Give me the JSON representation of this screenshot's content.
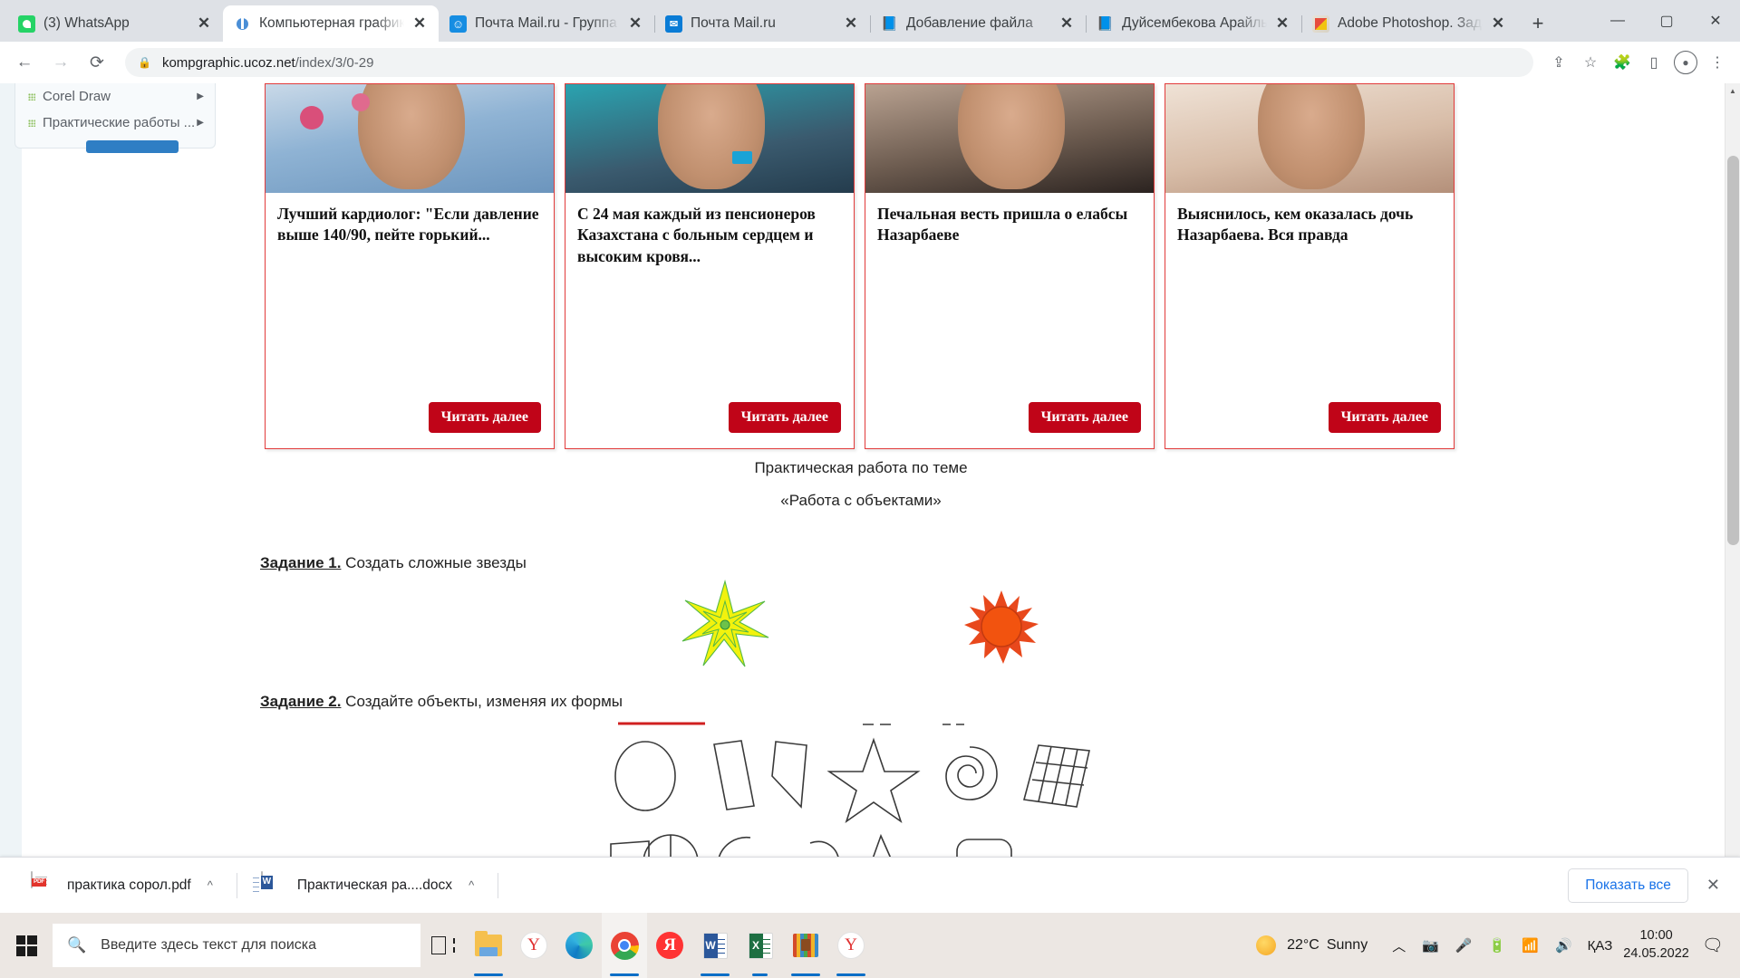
{
  "browser": {
    "tabs": [
      {
        "title": "(3) WhatsApp",
        "favicon": "whatsapp-icon",
        "active": false
      },
      {
        "title": "Компьютерная графика",
        "favicon": "ucoz-icon",
        "active": true
      },
      {
        "title": "Почта Mail.ru - Группа",
        "favicon": "mailru-icon",
        "active": false
      },
      {
        "title": "Почта Mail.ru",
        "favicon": "mailru-envelope-icon",
        "active": false
      },
      {
        "title": "Добавление файла",
        "favicon": "book-icon",
        "active": false
      },
      {
        "title": "Дуйсембекова Арайлым",
        "favicon": "book-icon",
        "active": false
      },
      {
        "title": "Adobe Photoshop. Задание",
        "favicon": "photoshop-icon",
        "active": false
      }
    ],
    "new_tab_label": "+",
    "window_controls": {
      "minimize": "—",
      "maximize": "▢",
      "close": "✕"
    },
    "nav": {
      "back": "←",
      "forward": "→",
      "reload": "⟳"
    },
    "address": {
      "lock_icon": "lock-icon",
      "host": "kompgraphic.ucoz.net",
      "path": "/index/3/0-29"
    },
    "toolbar_icons": [
      "share-icon",
      "bookmark-star-icon",
      "extensions-puzzle-icon",
      "sidepanel-icon",
      "profile-avatar-icon",
      "menu-kebab-icon"
    ]
  },
  "sidebar": {
    "items": [
      {
        "label": "Corel Draw",
        "arrow": "▶"
      },
      {
        "label": "Практические работы ...",
        "arrow": "▶"
      }
    ]
  },
  "news_cards": [
    {
      "title": "Лучший кардиолог: \"Если давление выше 140/90, пейте горький...",
      "button": "Читать далее"
    },
    {
      "title": "С 24 мая каждый из пенсионеров Казахстана с больным сердцем и высоким кровя...",
      "button": "Читать далее"
    },
    {
      "title": "Печальная весть пришла о елабсы Назарбаеве",
      "button": "Читать далее"
    },
    {
      "title": "Выяснилось, кем оказалась дочь Назарбаева. Вся правда",
      "button": "Читать далее"
    }
  ],
  "document": {
    "heading_line1": "Практическая работа по теме",
    "heading_line2": "«Работа с объектами»",
    "task1_label": "Задание 1.",
    "task1_text": " Создать сложные звезды",
    "task2_label": "Задание 2.",
    "task2_text": " Создайте объекты, изменяя их формы"
  },
  "downloads_bar": {
    "items": [
      {
        "name": "практика соpол.pdf",
        "icon": "pdf-file-icon",
        "caret": "^"
      },
      {
        "name": "Практическая ра....docx",
        "icon": "word-file-icon",
        "caret": "^"
      }
    ],
    "show_all": "Показать все",
    "close": "✕"
  },
  "taskbar": {
    "start_icon": "windows-start-icon",
    "search_placeholder": "Введите здесь текст для поиска",
    "search_icon": "search-icon",
    "apps": [
      {
        "name": "task-view-icon",
        "running": false
      },
      {
        "name": "file-explorer-icon",
        "running": true
      },
      {
        "name": "yandex-icon",
        "running": false
      },
      {
        "name": "microsoft-edge-icon",
        "running": false
      },
      {
        "name": "google-chrome-icon",
        "running": true,
        "active": true
      },
      {
        "name": "yandex-browser-icon",
        "running": false
      },
      {
        "name": "microsoft-word-icon",
        "running": true
      },
      {
        "name": "microsoft-excel-icon",
        "running": true
      },
      {
        "name": "winrar-icon",
        "running": true
      },
      {
        "name": "yandex-disk-icon",
        "running": true
      }
    ],
    "weather": {
      "temperature": "22°C",
      "condition": "Sunny"
    },
    "tray_icons": [
      "chevron-up-icon",
      "camera-icon",
      "microphone-icon",
      "battery-icon",
      "wifi-icon",
      "volume-icon"
    ],
    "language": "ҚАЗ",
    "time": "10:00",
    "date": "24.05.2022",
    "notification_icon": "notification-icon"
  },
  "colors": {
    "card_border": "#e23b3b",
    "card_button": "#c00418",
    "chrome_tabstrip": "#dee1e6",
    "accent_link": "#1a73e8",
    "taskbar": "#ece7e3"
  }
}
